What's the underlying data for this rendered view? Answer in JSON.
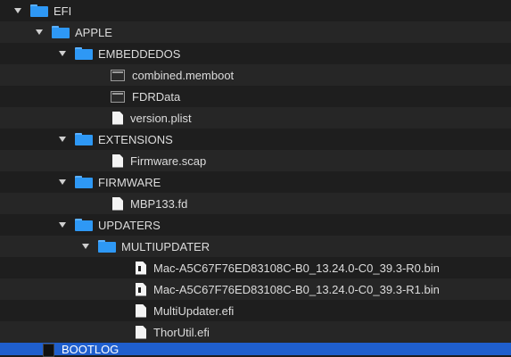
{
  "tree": [
    {
      "label": "EFI",
      "icon": "folder-icon",
      "expanded": true
    },
    {
      "label": "APPLE",
      "icon": "folder-icon",
      "expanded": true
    },
    {
      "label": "EMBEDDEDOS",
      "icon": "folder-icon",
      "expanded": true
    },
    {
      "label": "combined.memboot",
      "icon": "memory-file-icon"
    },
    {
      "label": "FDRData",
      "icon": "memory-file-icon"
    },
    {
      "label": "version.plist",
      "icon": "file-icon"
    },
    {
      "label": "EXTENSIONS",
      "icon": "folder-icon",
      "expanded": true
    },
    {
      "label": "Firmware.scap",
      "icon": "file-icon"
    },
    {
      "label": "FIRMWARE",
      "icon": "folder-icon",
      "expanded": true
    },
    {
      "label": "MBP133.fd",
      "icon": "file-icon"
    },
    {
      "label": "UPDATERS",
      "icon": "folder-icon",
      "expanded": true
    },
    {
      "label": "MULTIUPDATER",
      "icon": "folder-icon",
      "expanded": true
    },
    {
      "label": "Mac-A5C67F76ED83108C-B0_13.24.0-C0_39.3-R0.bin",
      "icon": "binary-file-icon"
    },
    {
      "label": "Mac-A5C67F76ED83108C-B0_13.24.0-C0_39.3-R1.bin",
      "icon": "binary-file-icon"
    },
    {
      "label": "MultiUpdater.efi",
      "icon": "file-icon"
    },
    {
      "label": "ThorUtil.efi",
      "icon": "file-icon"
    },
    {
      "label": "BOOTLOG",
      "icon": "dark-document-icon",
      "selected": true
    }
  ],
  "colors": {
    "background": "#1e1e1e",
    "selection": "#1f5fce",
    "folder": "#2e98f5"
  }
}
